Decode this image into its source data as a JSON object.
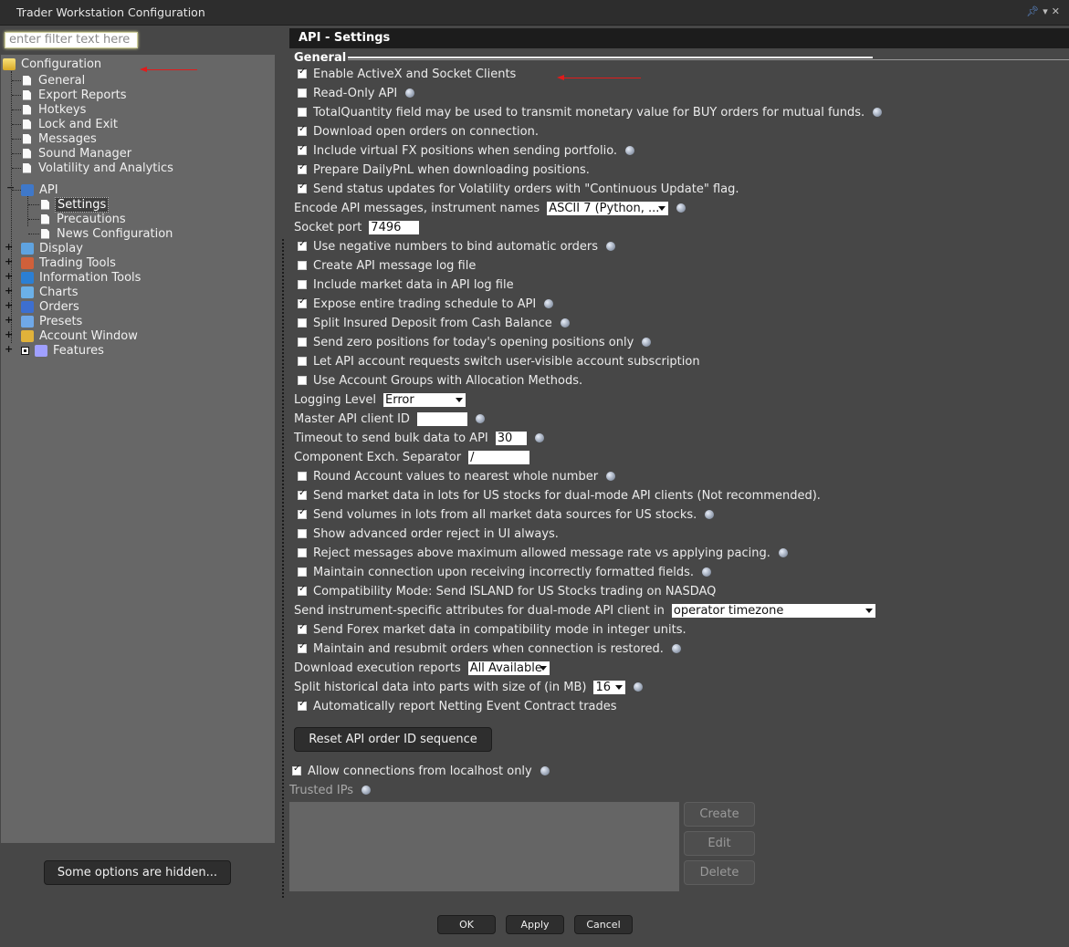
{
  "window": {
    "title": "Trader Workstation Configuration"
  },
  "filter": {
    "placeholder": "enter filter text here"
  },
  "tree": {
    "root": "Configuration",
    "items": [
      "General",
      "Export Reports",
      "Hotkeys",
      "Lock and Exit",
      "Messages",
      "Sound Manager",
      "Volatility and Analytics"
    ],
    "api": {
      "label": "API",
      "children": [
        "Settings",
        "Precautions",
        "News Configuration"
      ]
    },
    "groups": [
      "Display",
      "Trading Tools",
      "Information Tools",
      "Charts",
      "Orders",
      "Presets",
      "Account Window",
      "Features"
    ]
  },
  "hidden_options_label": "Some options are hidden...",
  "panel": {
    "title": "API - Settings",
    "section": "General",
    "options": [
      {
        "label": "Enable ActiveX and Socket Clients",
        "checked": true,
        "info": false
      },
      {
        "label": "Read-Only API",
        "checked": false,
        "info": true
      },
      {
        "label": "TotalQuantity field may be used to transmit monetary value for BUY orders for mutual funds.",
        "checked": false,
        "info": true
      },
      {
        "label": "Download open orders on connection.",
        "checked": true,
        "info": false
      },
      {
        "label": "Include virtual FX positions when sending portfolio.",
        "checked": true,
        "info": true
      },
      {
        "label": "Prepare DailyPnL when downloading positions.",
        "checked": true,
        "info": false
      },
      {
        "label": "Send status updates for Volatility orders with \"Continuous Update\" flag.",
        "checked": true,
        "info": false
      }
    ],
    "encode": {
      "label": "Encode API messages, instrument names",
      "value": "ASCII 7 (Python, ..."
    },
    "socket_port": {
      "label": "Socket port",
      "value": "7496"
    },
    "options2": [
      {
        "label": "Use negative numbers to bind automatic orders",
        "checked": true,
        "info": true
      },
      {
        "label": "Create API message log file",
        "checked": false,
        "info": false
      },
      {
        "label": "Include market data in API log file",
        "checked": false,
        "info": false
      },
      {
        "label": "Expose entire trading schedule to API",
        "checked": true,
        "info": true
      },
      {
        "label": "Split Insured Deposit from Cash Balance",
        "checked": false,
        "info": true
      },
      {
        "label": "Send zero positions for today's opening positions only",
        "checked": false,
        "info": true
      },
      {
        "label": "Let API account requests switch user-visible account subscription",
        "checked": false,
        "info": false
      },
      {
        "label": "Use Account Groups with Allocation Methods.",
        "checked": false,
        "info": false
      }
    ],
    "logging_level": {
      "label": "Logging Level",
      "value": "Error"
    },
    "master_client_id": {
      "label": "Master API client ID",
      "value": ""
    },
    "timeout": {
      "label": "Timeout to send bulk data to API",
      "value": "30"
    },
    "separator": {
      "label": "Component Exch. Separator",
      "value": "/"
    },
    "options3": [
      {
        "label": "Round Account values to nearest whole number",
        "checked": false,
        "info": true
      },
      {
        "label": "Send market data in lots for US stocks for dual-mode API clients (Not recommended).",
        "checked": true,
        "info": false
      },
      {
        "label": "Send volumes in lots from all market data sources for US stocks.",
        "checked": true,
        "info": true
      },
      {
        "label": "Show advanced order reject in UI always.",
        "checked": false,
        "info": false
      },
      {
        "label": "Reject messages above maximum allowed message rate vs applying pacing.",
        "checked": false,
        "info": true
      },
      {
        "label": "Maintain connection upon receiving incorrectly formatted fields.",
        "checked": false,
        "info": true
      },
      {
        "label": "Compatibility Mode: Send ISLAND for US Stocks trading on NASDAQ",
        "checked": true,
        "info": false
      }
    ],
    "instrument_attrs": {
      "label": "Send instrument-specific attributes for dual-mode API client in",
      "value": "operator timezone"
    },
    "options4": [
      {
        "label": "Send Forex market data in compatibility mode in integer units.",
        "checked": true,
        "info": false
      },
      {
        "label": "Maintain and resubmit orders when connection is restored.",
        "checked": true,
        "info": true
      }
    ],
    "exec_reports": {
      "label": "Download execution reports",
      "value": "All Available"
    },
    "split_hist": {
      "label": "Split historical data into parts with size of (in MB)",
      "value": "16"
    },
    "netting": {
      "label": "Automatically report Netting Event Contract trades",
      "checked": true
    },
    "reset_button": "Reset API order ID sequence",
    "localhost": {
      "label": "Allow connections from localhost only",
      "checked": true
    },
    "trusted_ips": {
      "label": "Trusted IPs"
    },
    "ip_buttons": {
      "create": "Create",
      "edit": "Edit",
      "delete": "Delete"
    }
  },
  "footer": {
    "ok": "OK",
    "apply": "Apply",
    "cancel": "Cancel"
  },
  "colors": {
    "annotation_arrow": "#e21b1b",
    "background": "#474747",
    "tree_bg": "#676767"
  }
}
